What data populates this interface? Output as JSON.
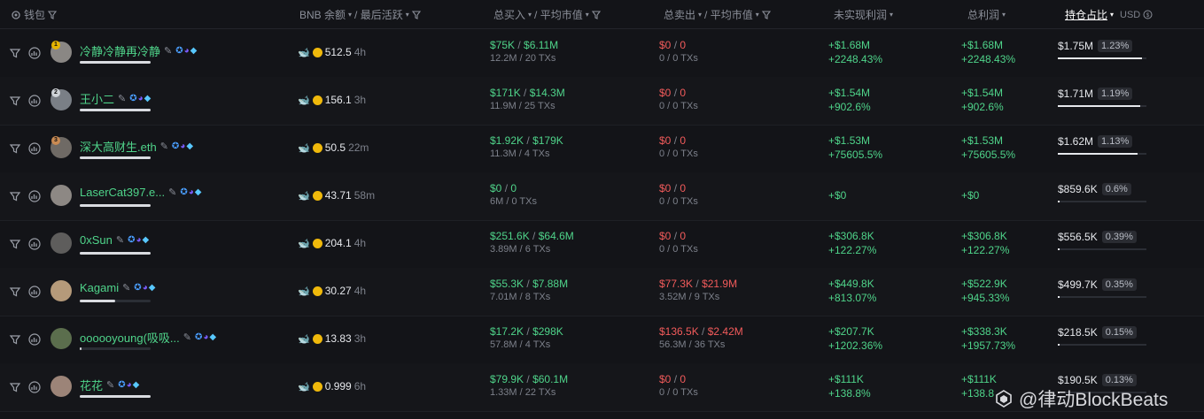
{
  "header": {
    "wallet_label": "钱包",
    "bnb_label": "BNB 余额",
    "last_active_label": "/ 最后活跃",
    "total_buy_label": "总买入",
    "avg_cap_buy_label": "/ 平均市值",
    "total_sell_label": "总卖出",
    "avg_cap_sell_label": "/ 平均市值",
    "unrealized_label": "未实现利润",
    "total_profit_label": "总利润",
    "holding_label": "持仓占比",
    "currency_label": "USD"
  },
  "rows": [
    {
      "rank": "1",
      "name": "冷静冷静再冷静",
      "bnb": "512.5",
      "active": "4h",
      "buy": "$75K",
      "buy_cap": "$6.11M",
      "buy_sub": "12.2M / 20 TXs",
      "sell": "$0",
      "sell_cap": "0",
      "sell_sub": "0 / 0 TXs",
      "unreal": "+$1.68M",
      "unreal_pct": "+2248.43%",
      "profit": "+$1.68M",
      "profit_pct": "+2248.43%",
      "hold": "$1.75M",
      "hold_pct": "1.23%",
      "hold_frac": 0.95,
      "bar_frac": 1.0
    },
    {
      "rank": "2",
      "name": "王小二",
      "bnb": "156.1",
      "active": "3h",
      "buy": "$171K",
      "buy_cap": "$14.3M",
      "buy_sub": "11.9M / 25 TXs",
      "sell": "$0",
      "sell_cap": "0",
      "sell_sub": "0 / 0 TXs",
      "unreal": "+$1.54M",
      "unreal_pct": "+902.6%",
      "profit": "+$1.54M",
      "profit_pct": "+902.6%",
      "hold": "$1.71M",
      "hold_pct": "1.19%",
      "hold_frac": 0.93,
      "bar_frac": 1.0
    },
    {
      "rank": "3",
      "name": "深大高财生.eth",
      "bnb": "50.5",
      "active": "22m",
      "buy": "$1.92K",
      "buy_cap": "$179K",
      "buy_sub": "11.3M / 4 TXs",
      "sell": "$0",
      "sell_cap": "0",
      "sell_sub": "0 / 0 TXs",
      "unreal": "+$1.53M",
      "unreal_pct": "+75605.5%",
      "profit": "+$1.53M",
      "profit_pct": "+75605.5%",
      "hold": "$1.62M",
      "hold_pct": "1.13%",
      "hold_frac": 0.9,
      "bar_frac": 1.0
    },
    {
      "rank": "",
      "name": "LaserCat397.e...",
      "bnb": "43.71",
      "active": "58m",
      "buy": "$0",
      "buy_cap": "0",
      "buy_sub": "6M / 0 TXs",
      "sell": "$0",
      "sell_cap": "0",
      "sell_sub": "0 / 0 TXs",
      "unreal": "+$0",
      "unreal_pct": "",
      "profit": "+$0",
      "profit_pct": "",
      "hold": "$859.6K",
      "hold_pct": "0.6%",
      "hold_frac": 0.02,
      "bar_frac": 1.0
    },
    {
      "rank": "",
      "name": "0xSun",
      "bnb": "204.1",
      "active": "4h",
      "buy": "$251.6K",
      "buy_cap": "$64.6M",
      "buy_sub": "3.89M / 6 TXs",
      "sell": "$0",
      "sell_cap": "0",
      "sell_sub": "0 / 0 TXs",
      "unreal": "+$306.8K",
      "unreal_pct": "+122.27%",
      "profit": "+$306.8K",
      "profit_pct": "+122.27%",
      "hold": "$556.5K",
      "hold_pct": "0.39%",
      "hold_frac": 0.02,
      "bar_frac": 1.0
    },
    {
      "rank": "",
      "name": "Kagami",
      "bnb": "30.27",
      "active": "4h",
      "buy": "$55.3K",
      "buy_cap": "$7.88M",
      "buy_sub": "7.01M / 8 TXs",
      "sell": "$77.3K",
      "sell_cap": "$21.9M",
      "sell_sub": "3.52M / 9 TXs",
      "unreal": "+$449.8K",
      "unreal_pct": "+813.07%",
      "profit": "+$522.9K",
      "profit_pct": "+945.33%",
      "hold": "$499.7K",
      "hold_pct": "0.35%",
      "hold_frac": 0.02,
      "bar_frac": 0.5
    },
    {
      "rank": "",
      "name": "oooooyoung(吸吸...",
      "bnb": "13.83",
      "active": "3h",
      "buy": "$17.2K",
      "buy_cap": "$298K",
      "buy_sub": "57.8M / 4 TXs",
      "sell": "$136.5K",
      "sell_cap": "$2.42M",
      "sell_sub": "56.3M / 36 TXs",
      "unreal": "+$207.7K",
      "unreal_pct": "+1202.36%",
      "profit": "+$338.3K",
      "profit_pct": "+1957.73%",
      "hold": "$218.5K",
      "hold_pct": "0.15%",
      "hold_frac": 0.02,
      "bar_frac": 0.03
    },
    {
      "rank": "",
      "name": "花花",
      "bnb": "0.999",
      "active": "6h",
      "buy": "$79.9K",
      "buy_cap": "$60.1M",
      "buy_sub": "1.33M / 22 TXs",
      "sell": "$0",
      "sell_cap": "0",
      "sell_sub": "0 / 0 TXs",
      "unreal": "+$111K",
      "unreal_pct": "+138.8%",
      "profit": "+$111K",
      "profit_pct": "+138.8",
      "hold": "$190.5K",
      "hold_pct": "0.13%",
      "hold_frac": 0.02,
      "bar_frac": 1.0
    }
  ],
  "watermark": "@律动BlockBeats"
}
